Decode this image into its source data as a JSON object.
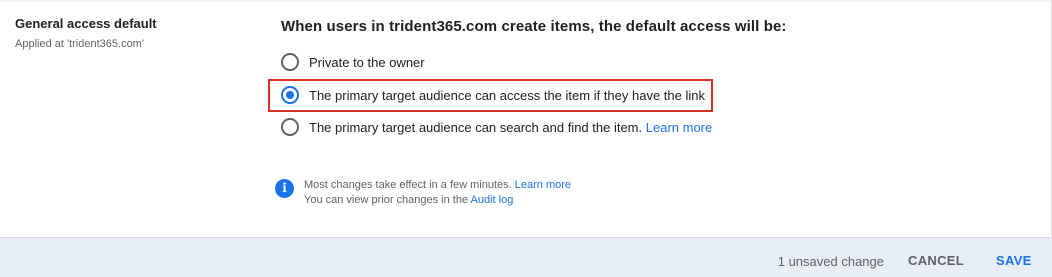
{
  "setting": {
    "title": "General access default",
    "subtitle": "Applied at 'trident365.com'"
  },
  "heading": "When users in trident365.com create items, the default access will be:",
  "options": [
    {
      "label": "Private to the owner",
      "checked": false
    },
    {
      "label": "The primary target audience can access the item if they have the link",
      "checked": true
    },
    {
      "label": "The primary target audience can search and find the item.",
      "link": "Learn more",
      "checked": false
    }
  ],
  "info": {
    "icon": "info-icon",
    "line1": "Most changes take effect in a few minutes.",
    "line1_link": "Learn more",
    "line2": "You can view prior changes in the",
    "line2_link": "Audit log"
  },
  "footer": {
    "unsaved": "1 unsaved change",
    "cancel": "CANCEL",
    "save": "SAVE"
  },
  "colors": {
    "accent": "#1a73e8",
    "highlight": "#d93025",
    "footer_bg": "#e8eef8"
  }
}
